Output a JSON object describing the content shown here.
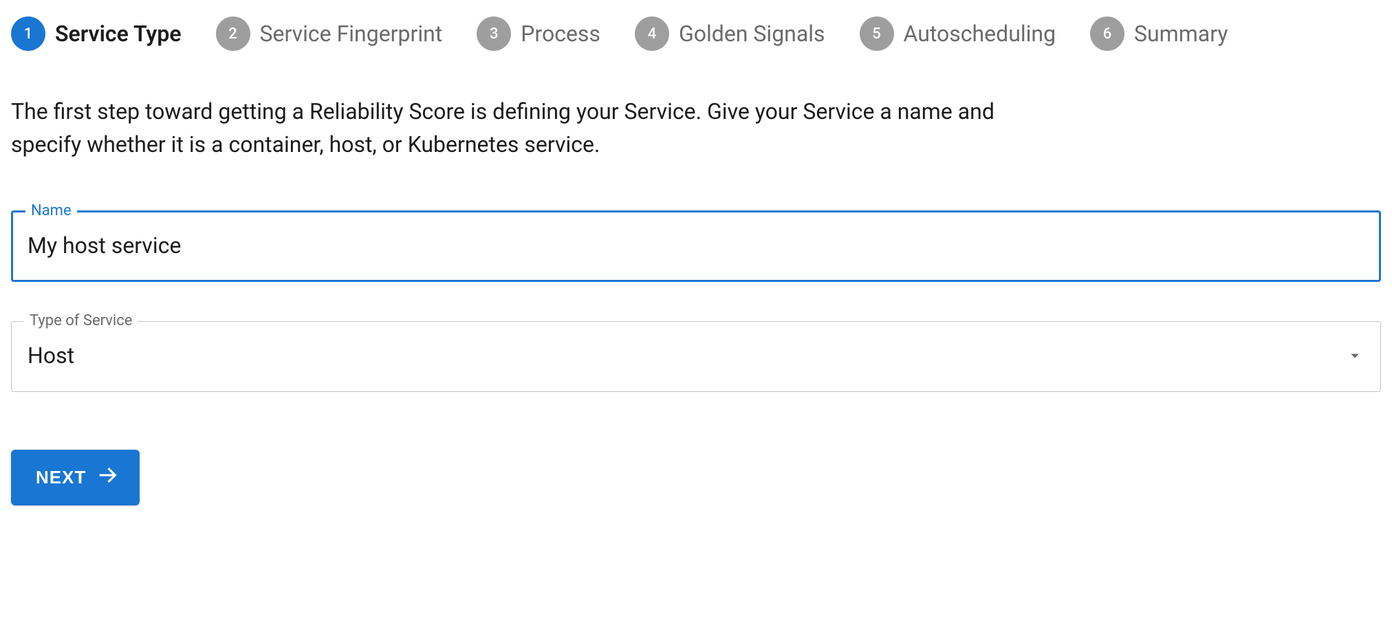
{
  "colors": {
    "accent": "#1976d2",
    "muted": "#9e9e9e"
  },
  "stepper": {
    "steps": [
      {
        "num": "1",
        "label": "Service Type",
        "active": true
      },
      {
        "num": "2",
        "label": "Service Fingerprint",
        "active": false
      },
      {
        "num": "3",
        "label": "Process",
        "active": false
      },
      {
        "num": "4",
        "label": "Golden Signals",
        "active": false
      },
      {
        "num": "5",
        "label": "Autoscheduling",
        "active": false
      },
      {
        "num": "6",
        "label": "Summary",
        "active": false
      }
    ]
  },
  "description": "The first step toward getting a Reliability Score is defining your Service. Give your Service a name and specify whether it is a container, host, or Kubernetes service.",
  "form": {
    "name": {
      "label": "Name",
      "value": "My host service"
    },
    "type": {
      "label": "Type of Service",
      "value": "Host"
    }
  },
  "actions": {
    "next": "NEXT"
  }
}
